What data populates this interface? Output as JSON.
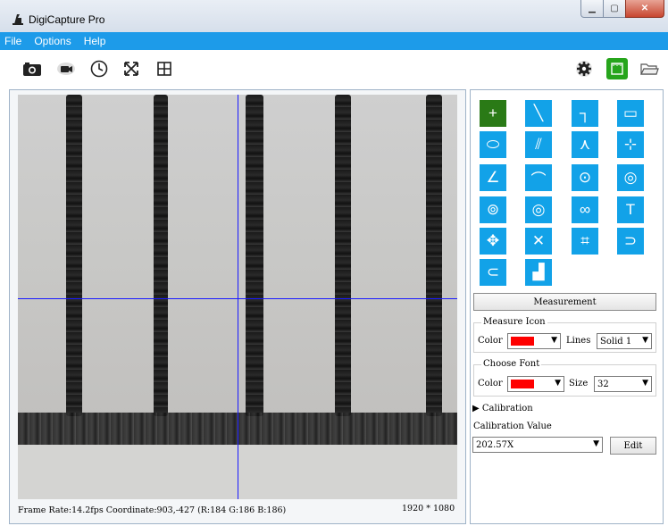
{
  "window": {
    "title": "DigiCapture Pro",
    "min_icon": "minimize-icon",
    "max_icon": "maximize-icon",
    "close_icon": "close-icon"
  },
  "menu": [
    "File",
    "Options",
    "Help"
  ],
  "toolbar": {
    "left": [
      "camera-icon",
      "video-icon",
      "timer-icon",
      "fullscreen-icon",
      "grid-icon"
    ],
    "right": [
      "settings-icon",
      "measure-panel-icon",
      "open-folder-icon"
    ]
  },
  "viewport": {
    "status": "Frame Rate:14.2fps Coordinate:903,-427 (R:184 G:186 B:186)",
    "resolution": "1920 * 1080",
    "crosshair_color": "#1a1aff"
  },
  "tools": [
    {
      "name": "crosshair-tool",
      "glyph": "+",
      "active": true
    },
    {
      "name": "line-tool",
      "glyph": "╲"
    },
    {
      "name": "step-line-tool",
      "glyph": "┐"
    },
    {
      "name": "rectangle-tool",
      "glyph": "▭"
    },
    {
      "name": "polygon-tool",
      "glyph": "⬭"
    },
    {
      "name": "parallel-lines-tool",
      "glyph": "⫽"
    },
    {
      "name": "angle-lines-tool",
      "glyph": "⋏"
    },
    {
      "name": "center-point-tool",
      "glyph": "⊹"
    },
    {
      "name": "angle-tool",
      "glyph": "∠"
    },
    {
      "name": "arc-tool",
      "glyph": "⌒"
    },
    {
      "name": "circle-center-tool",
      "glyph": "⊙"
    },
    {
      "name": "circle-points-tool",
      "glyph": "◎"
    },
    {
      "name": "three-point-circle-tool",
      "glyph": "⊚"
    },
    {
      "name": "concentric-circle-tool",
      "glyph": "◎"
    },
    {
      "name": "two-circles-tool",
      "glyph": "∞"
    },
    {
      "name": "text-tool",
      "glyph": "T"
    },
    {
      "name": "move-tool",
      "glyph": "✥"
    },
    {
      "name": "delete-tool",
      "glyph": "✕"
    },
    {
      "name": "crop-tool",
      "glyph": "⌗"
    },
    {
      "name": "undo-tool",
      "glyph": "⊃"
    },
    {
      "name": "redo-tool",
      "glyph": "⊂"
    },
    {
      "name": "clear-tool",
      "glyph": "▟"
    }
  ],
  "panel": {
    "measurement_label": "Measurement",
    "measure_icon": {
      "title": "Measure Icon",
      "color_label": "Color",
      "color": "#ff0000",
      "lines_label": "Lines",
      "lines_value": "Solid 1"
    },
    "choose_font": {
      "title": "Choose Font",
      "color_label": "Color",
      "color": "#ff0000",
      "size_label": "Size",
      "size_value": "32"
    },
    "calibration_label": "Calibration",
    "calibration_value_label": "Calibration Value",
    "calibration_value": "202.57X",
    "edit_label": "Edit"
  },
  "colors": {
    "menu_bar": "#1d9be9",
    "tool_button": "#12a2e8",
    "tool_active": "#2a7a16"
  }
}
